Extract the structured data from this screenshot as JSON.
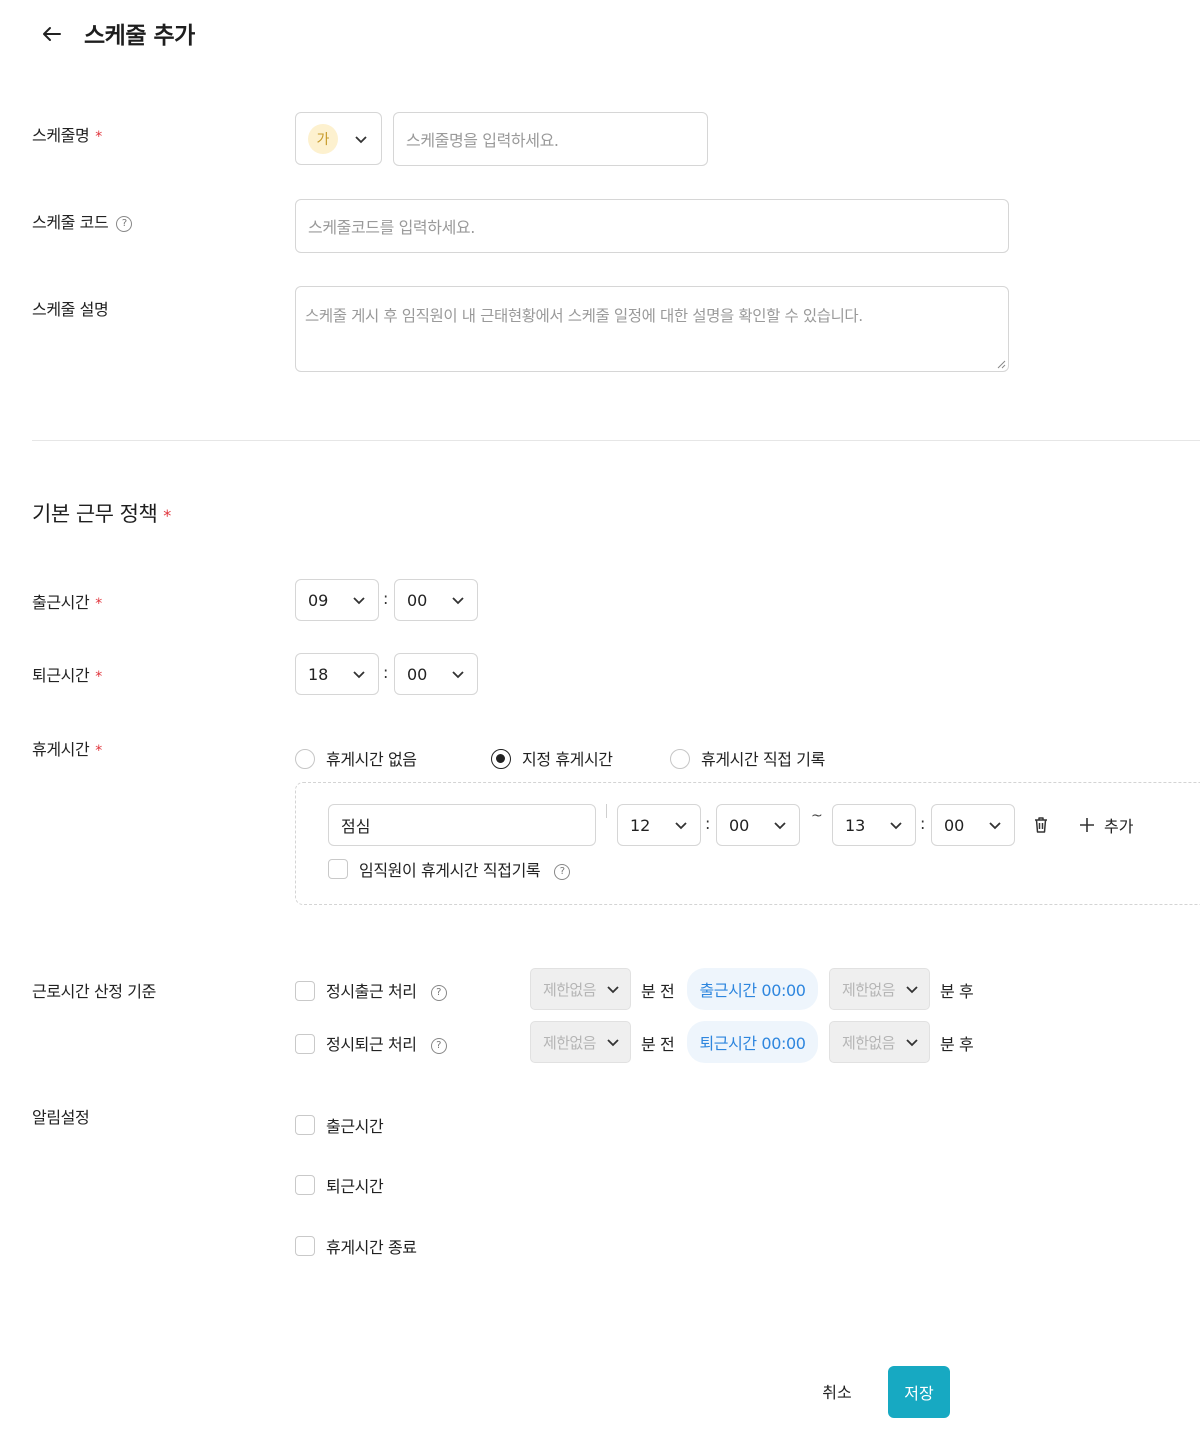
{
  "header": {
    "title": "스케줄 추가",
    "back_icon": "arrow-left-icon"
  },
  "form": {
    "name": {
      "label": "스케줄명",
      "required_mark": "*",
      "color_chip": "가",
      "placeholder": "스케줄명을 입력하세요."
    },
    "code": {
      "label": "스케줄 코드",
      "help": "?",
      "placeholder": "스케줄코드를 입력하세요."
    },
    "description": {
      "label": "스케줄 설명",
      "placeholder": "스케줄 게시 후 임직원이 내 근태현황에서 스케줄 일정에 대한 설명을 확인할 수 있습니다."
    }
  },
  "policy": {
    "title": "기본 근무 정책",
    "required_mark": "*",
    "check_in": {
      "label": "출근시간",
      "hour": "09",
      "minute": "00"
    },
    "check_out": {
      "label": "퇴근시간",
      "hour": "18",
      "minute": "00"
    },
    "break": {
      "label": "휴게시간",
      "options": [
        "휴게시간 없음",
        "지정 휴게시간",
        "휴게시간 직접 기록"
      ],
      "selected_index": 1,
      "item": {
        "name": "점심",
        "start_hour": "12",
        "start_minute": "00",
        "tilde": "~",
        "end_hour": "13",
        "end_minute": "00",
        "add_label": "추가",
        "self_record_label": "임직원이 휴게시간 직접기록"
      }
    },
    "calc": {
      "label": "근로시간 산정 기준",
      "rows": [
        {
          "check_label": "정시출근 처리",
          "before_select": "제한없음",
          "before_text": "분 전",
          "pill": "출근시간 00:00",
          "after_select": "제한없음",
          "after_text": "분 후"
        },
        {
          "check_label": "정시퇴근 처리",
          "before_select": "제한없음",
          "before_text": "분 전",
          "pill": "퇴근시간 00:00",
          "after_select": "제한없음",
          "after_text": "분 후"
        }
      ]
    },
    "alarm": {
      "label": "알림설정",
      "options": [
        "출근시간",
        "퇴근시간",
        "휴게시간 종료"
      ]
    }
  },
  "footer": {
    "cancel_label": "취소",
    "save_label": "저장"
  },
  "colors": {
    "accent": "#17a9c2",
    "required": "#e0343c",
    "link": "#2e86de",
    "chip_bg": "#fdf1cf"
  }
}
